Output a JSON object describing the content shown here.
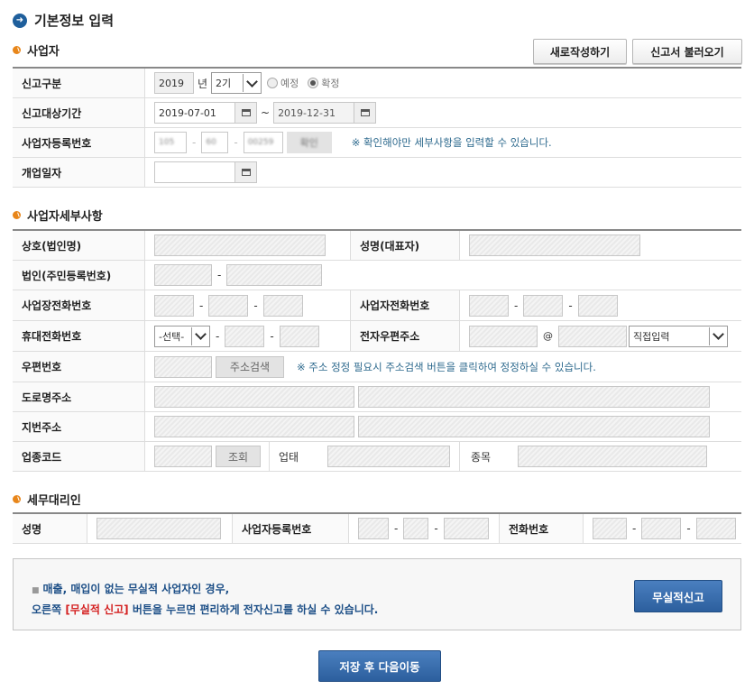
{
  "page_title": "기본정보 입력",
  "sections": {
    "business": "사업자",
    "details": "사업자세부사항",
    "agent": "세무대리인"
  },
  "top_buttons": {
    "new_write": "새로작성하기",
    "load_report": "신고서 불러오기"
  },
  "business": {
    "report_type_label": "신고구분",
    "year": "2019",
    "year_unit": "년",
    "period": "2기",
    "radio_expected": "예정",
    "radio_confirmed": "확정",
    "period_label": "신고대상기간",
    "start_date": "2019-07-01",
    "tilde": "~",
    "end_date": "2019-12-31",
    "reg_no_label": "사업자등록번호",
    "reg_no_1": "105",
    "reg_no_2": "60",
    "reg_no_3": "00259",
    "confirm_btn": "확인",
    "confirm_note": "※ 확인해야만 세부사항을 입력할 수 있습니다.",
    "open_date_label": "개업일자"
  },
  "details": {
    "company_name_label": "상호(법인명)",
    "rep_name_label": "성명(대표자)",
    "corp_no_label": "법인(주민등록번호)",
    "biz_phone_label": "사업장전화번호",
    "owner_phone_label": "사업자전화번호",
    "mobile_label": "휴대전화번호",
    "mobile_select": "-선택-",
    "email_label": "전자우편주소",
    "at": "@",
    "email_domain_select": "직접입력",
    "zip_label": "우편번호",
    "addr_search_btn": "주소검색",
    "addr_note": "※ 주소 정정 필요시 주소검색 버튼을 클릭하여 정정하실 수 있습니다.",
    "road_addr_label": "도로명주소",
    "lot_addr_label": "지번주소",
    "biz_code_label": "업종코드",
    "lookup_btn": "조회",
    "biz_type_label": "업태",
    "biz_item_label": "종목"
  },
  "agent": {
    "name_label": "성명",
    "reg_no_label": "사업자등록번호",
    "phone_label": "전화번호"
  },
  "info": {
    "line1": "매출, 매입이 없는 무실적 사업자인 경우,",
    "line2_pre": "오른쪽 ",
    "line2_red": "[무실적 신고]",
    "line2_post": " 버튼을 누르면 편리하게 전자신고를 하실 수 있습니다.",
    "no_record_btn": "무실적신고"
  },
  "save_next_btn": "저장 후 다음이동",
  "colors": {
    "accent_blue": "#2c5f9e",
    "bullet_orange": "#e8861a",
    "note_teal": "#2e6a8e",
    "highlight_red": "#d42020"
  }
}
